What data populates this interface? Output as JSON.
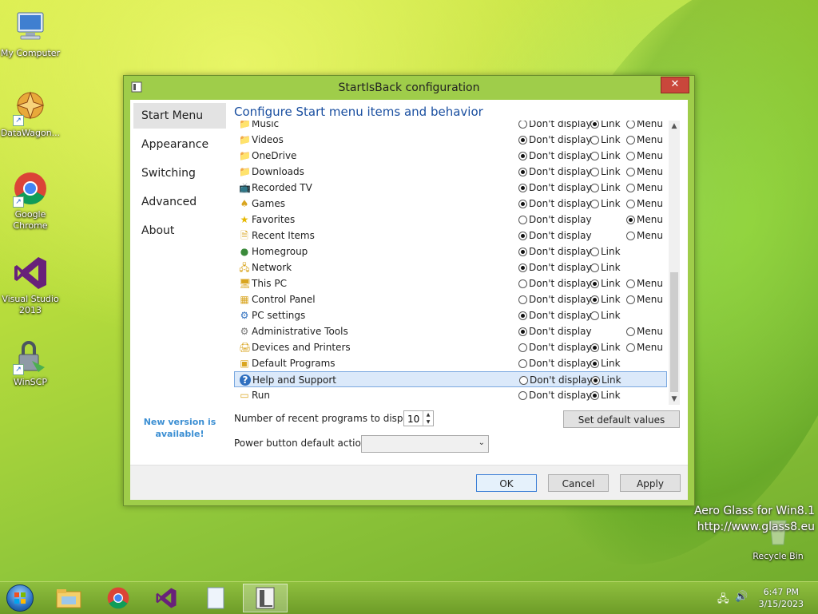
{
  "desktop": {
    "icons": [
      {
        "label": "My Computer"
      },
      {
        "label": "DataWagon..."
      },
      {
        "label": "Google Chrome"
      },
      {
        "label": "Visual Studio 2013"
      },
      {
        "label": "WinSCP"
      }
    ],
    "recycle_bin": "Recycle Bin",
    "watermark_line1": "Aero Glass for Win8.1",
    "watermark_line2": "http://www.glass8.eu"
  },
  "window": {
    "title": "StartIsBack configuration",
    "close_label": "✕",
    "sidebar": [
      "Start Menu",
      "Appearance",
      "Switching",
      "Advanced",
      "About"
    ],
    "sidebar_active": 0,
    "new_version": "New version is available!",
    "heading": "Configure Start menu items and behavior",
    "option_labels": {
      "dont": "Don't display",
      "link": "Link",
      "menu": "Menu"
    },
    "items": [
      {
        "name": "Music",
        "icon": "music-folder-icon",
        "options": [
          "dont",
          "link",
          "menu"
        ],
        "selected": "link"
      },
      {
        "name": "Videos",
        "icon": "videos-folder-icon",
        "options": [
          "dont",
          "link",
          "menu"
        ],
        "selected": "dont"
      },
      {
        "name": "OneDrive",
        "icon": "onedrive-folder-icon",
        "options": [
          "dont",
          "link",
          "menu"
        ],
        "selected": "dont"
      },
      {
        "name": "Downloads",
        "icon": "downloads-folder-icon",
        "options": [
          "dont",
          "link",
          "menu"
        ],
        "selected": "dont"
      },
      {
        "name": "Recorded TV",
        "icon": "recorded-tv-icon",
        "options": [
          "dont",
          "link",
          "menu"
        ],
        "selected": "dont"
      },
      {
        "name": "Games",
        "icon": "games-icon",
        "options": [
          "dont",
          "link",
          "menu"
        ],
        "selected": "dont"
      },
      {
        "name": "Favorites",
        "icon": "favorites-star-icon",
        "options": [
          "dont",
          "menu"
        ],
        "selected": "menu"
      },
      {
        "name": "Recent Items",
        "icon": "recent-items-icon",
        "options": [
          "dont",
          "menu"
        ],
        "selected": "dont"
      },
      {
        "name": "Homegroup",
        "icon": "homegroup-icon",
        "options": [
          "dont",
          "link"
        ],
        "selected": "dont"
      },
      {
        "name": "Network",
        "icon": "network-icon",
        "options": [
          "dont",
          "link"
        ],
        "selected": "dont"
      },
      {
        "name": "This PC",
        "icon": "this-pc-icon",
        "options": [
          "dont",
          "link",
          "menu"
        ],
        "selected": "link"
      },
      {
        "name": "Control Panel",
        "icon": "control-panel-icon",
        "options": [
          "dont",
          "link",
          "menu"
        ],
        "selected": "link"
      },
      {
        "name": "PC settings",
        "icon": "pc-settings-gear-icon",
        "options": [
          "dont",
          "link"
        ],
        "selected": "dont"
      },
      {
        "name": "Administrative Tools",
        "icon": "admin-tools-icon",
        "options": [
          "dont",
          "menu"
        ],
        "selected": "dont"
      },
      {
        "name": "Devices and Printers",
        "icon": "devices-printers-icon",
        "options": [
          "dont",
          "link",
          "menu"
        ],
        "selected": "link"
      },
      {
        "name": "Default Programs",
        "icon": "default-programs-icon",
        "options": [
          "dont",
          "link"
        ],
        "selected": "link"
      },
      {
        "name": "Help and Support",
        "icon": "help-question-icon",
        "options": [
          "dont",
          "link"
        ],
        "selected": "link",
        "highlighted": true
      },
      {
        "name": "Run",
        "icon": "run-icon",
        "options": [
          "dont",
          "link"
        ],
        "selected": "link"
      }
    ],
    "recent_label": "Number of recent programs to display:",
    "recent_value": "10",
    "set_default": "Set default values",
    "power_label": "Power button default action:",
    "power_value": "",
    "ok": "OK",
    "cancel": "Cancel",
    "apply": "Apply"
  },
  "taskbar": {
    "apps": [
      "file-explorer-icon",
      "chrome-icon",
      "visual-studio-icon",
      "notepad-icon",
      "startisback-config-icon"
    ],
    "active_index": 4,
    "time": "6:47 PM",
    "date": "3/15/2023"
  }
}
